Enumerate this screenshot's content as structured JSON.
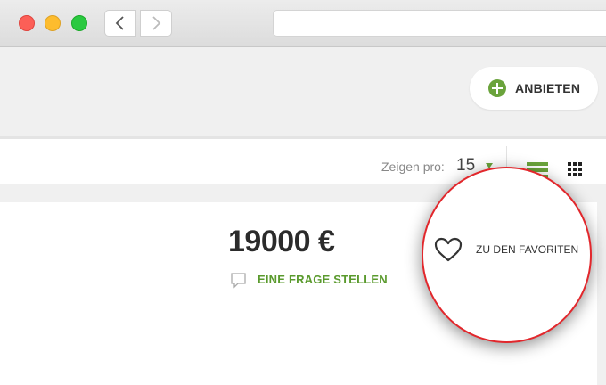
{
  "browser": {
    "back_icon": "chevron-left-icon",
    "forward_icon": "chevron-right-icon",
    "address": ""
  },
  "header": {
    "offer_button": {
      "label": "ANBIETEN",
      "icon": "plus-circle-icon",
      "color": "#6aa33b"
    }
  },
  "toolbar": {
    "per_page_label": "Zeigen pro:",
    "per_page_value": "15",
    "list_view_icon": "list-view-icon",
    "grid_view_icon": "grid-view-icon",
    "accent": "#6aa33b"
  },
  "listing": {
    "price": "19000 €",
    "ask_question_label": "EINE FRAGE STELLEN",
    "favorite_label": "ZU DEN FAVORITEN",
    "highlight_color": "#e2272c"
  }
}
